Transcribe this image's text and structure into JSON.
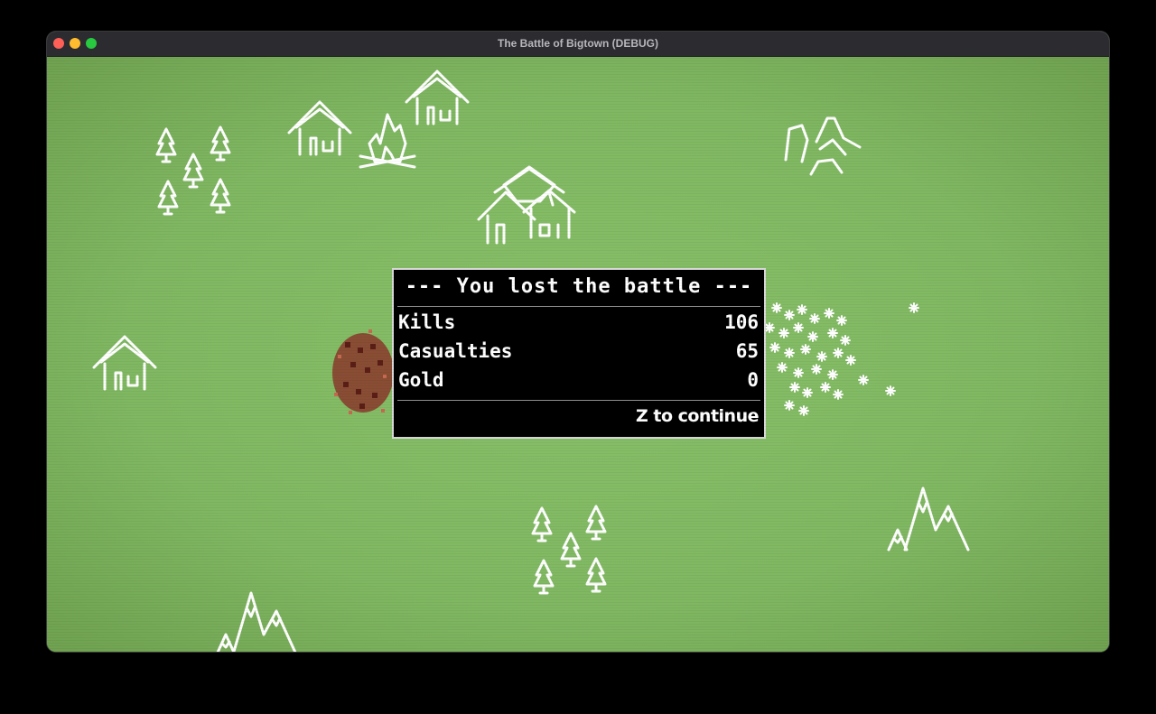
{
  "window": {
    "title": "The Battle of Bigtown (DEBUG)"
  },
  "battle_result": {
    "heading": "--- You lost the battle ---",
    "stats": [
      {
        "label": "Kills",
        "value": "106"
      },
      {
        "label": "Casualties",
        "value": "65"
      },
      {
        "label": "Gold",
        "value": "0"
      }
    ],
    "continue_prompt": "Z to continue"
  },
  "colors": {
    "grass": "#80b862",
    "sprite": "#ffffff",
    "player_army": "#8a3a2c",
    "dialog_bg": "#000000"
  }
}
